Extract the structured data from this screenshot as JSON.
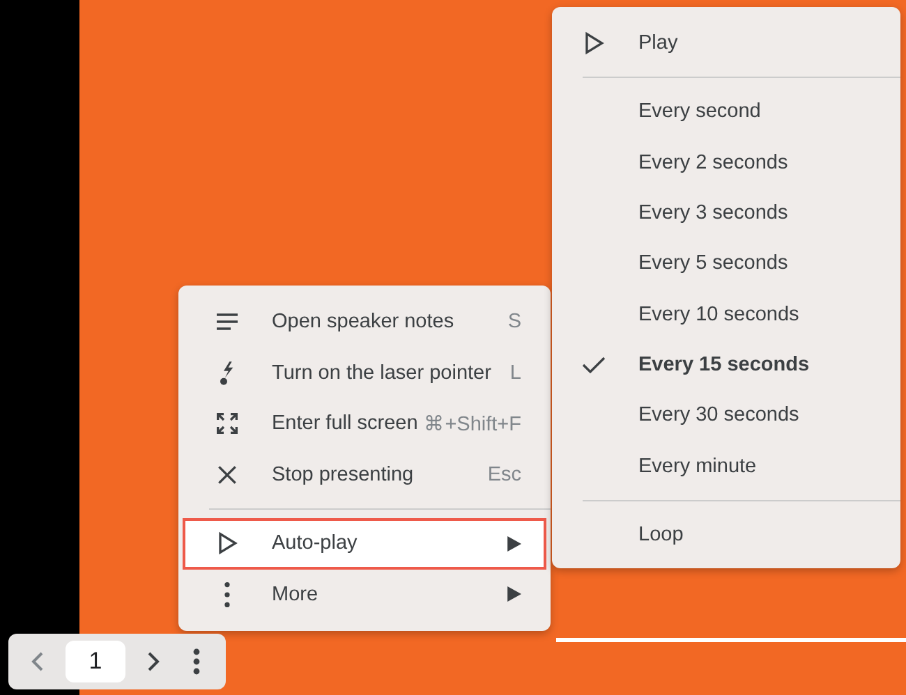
{
  "menu": {
    "items": [
      {
        "kind": "action",
        "label": "Open speaker notes",
        "shortcut": "S",
        "selected": false
      },
      {
        "kind": "action",
        "label": "Turn on the laser pointer",
        "shortcut": "L",
        "selected": false
      },
      {
        "kind": "action",
        "label": "Enter full screen",
        "shortcut": "⌘+Shift+F",
        "selected": false
      },
      {
        "kind": "action",
        "label": "Stop presenting",
        "shortcut": "Esc",
        "selected": false
      },
      {
        "kind": "submenu",
        "label": "Auto-play",
        "selected": true
      },
      {
        "kind": "submenu",
        "label": "More",
        "selected": false
      }
    ]
  },
  "submenu": {
    "play": "Play",
    "options": [
      {
        "label": "Every second",
        "checked": false
      },
      {
        "label": "Every 2 seconds",
        "checked": false
      },
      {
        "label": "Every 3 seconds",
        "checked": false
      },
      {
        "label": "Every 5 seconds",
        "checked": false
      },
      {
        "label": "Every 10 seconds",
        "checked": false
      },
      {
        "label": "Every 15 seconds",
        "checked": true
      },
      {
        "label": "Every 30 seconds",
        "checked": false
      },
      {
        "label": "Every minute",
        "checked": false
      }
    ],
    "loop": "Loop"
  },
  "nav": {
    "page": "1"
  }
}
